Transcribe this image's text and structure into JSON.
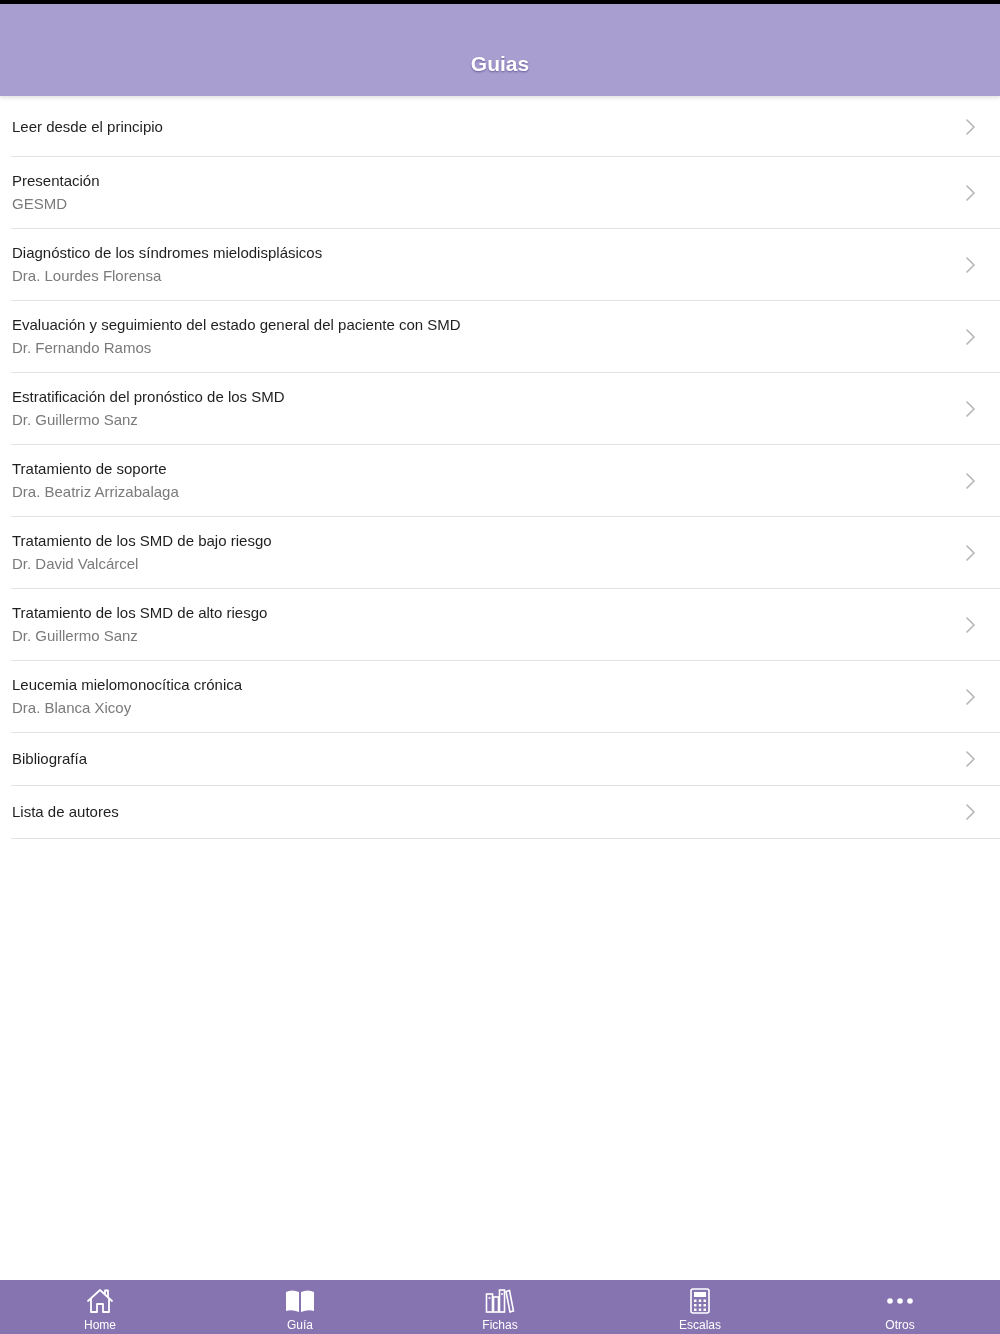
{
  "header": {
    "title": "Guias"
  },
  "list": [
    {
      "title": "Leer desde el principio"
    },
    {
      "title": "Presentación",
      "subtitle": "GESMD"
    },
    {
      "title": "Diagnóstico de los síndromes mielodisplásicos",
      "subtitle": "Dra. Lourdes Florensa"
    },
    {
      "title": "Evaluación y seguimiento del estado general del paciente con SMD",
      "subtitle": "Dr. Fernando Ramos"
    },
    {
      "title": "Estratificación del pronóstico de los SMD",
      "subtitle": "Dr. Guillermo Sanz"
    },
    {
      "title": "Tratamiento de soporte",
      "subtitle": "Dra. Beatriz Arrizabalaga"
    },
    {
      "title": "Tratamiento de los SMD de bajo riesgo",
      "subtitle": "Dr. David Valcárcel"
    },
    {
      "title": "Tratamiento de los SMD de alto riesgo",
      "subtitle": "Dr. Guillermo Sanz"
    },
    {
      "title": "Leucemia mielomonocítica crónica",
      "subtitle": "Dra. Blanca Xicoy"
    },
    {
      "title": "Bibliografía"
    },
    {
      "title": "Lista de autores"
    }
  ],
  "tab_bar": [
    {
      "kind": "home",
      "label": "Home"
    },
    {
      "kind": "book",
      "label": "Guía"
    },
    {
      "kind": "books",
      "label": "Fichas"
    },
    {
      "kind": "calculator",
      "label": "Escalas"
    },
    {
      "kind": "more",
      "label": "Otros"
    }
  ]
}
